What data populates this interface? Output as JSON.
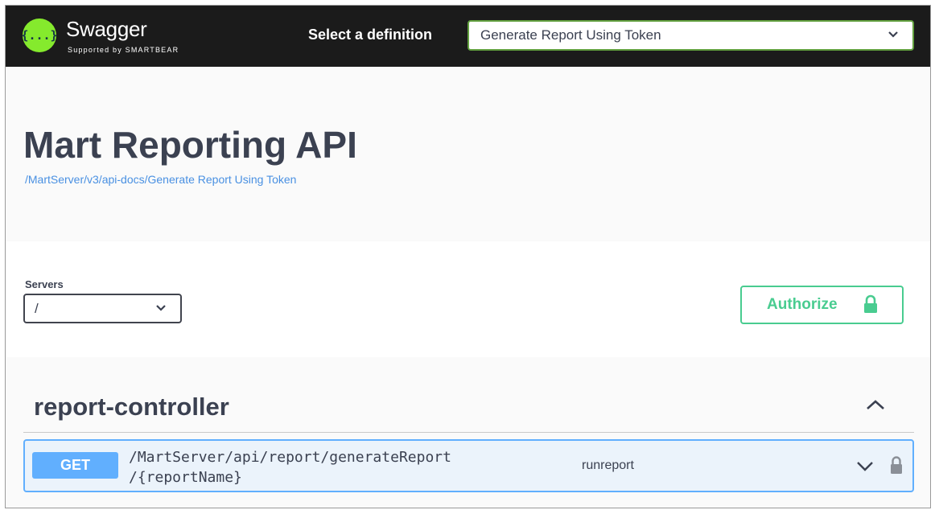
{
  "topbar": {
    "logo_glyph": "{...}",
    "brand": "Swagger",
    "brand_sub": "Supported by SMARTBEAR",
    "definition_label": "Select a definition",
    "definition_value": "Generate Report Using Token",
    "colors": {
      "background": "#1b1b1b",
      "logo": "#85ea2d",
      "select_border": "#62a03f"
    }
  },
  "info": {
    "title": "Mart Reporting API",
    "url": "/MartServer/v3/api-docs/Generate Report Using Token"
  },
  "servers": {
    "label": "Servers",
    "value": "/"
  },
  "authorize": {
    "label": "Authorize",
    "icon": "lock-icon",
    "color": "#49cc90"
  },
  "tag": {
    "name": "report-controller",
    "expanded": true
  },
  "operation": {
    "method": "GET",
    "path_line1": "/MartServer/api/report/generateReport",
    "path_line2": "/{reportName}",
    "summary": "runreport",
    "method_color": "#61affe",
    "icons": [
      "chevron-down-icon",
      "lock-icon"
    ]
  }
}
